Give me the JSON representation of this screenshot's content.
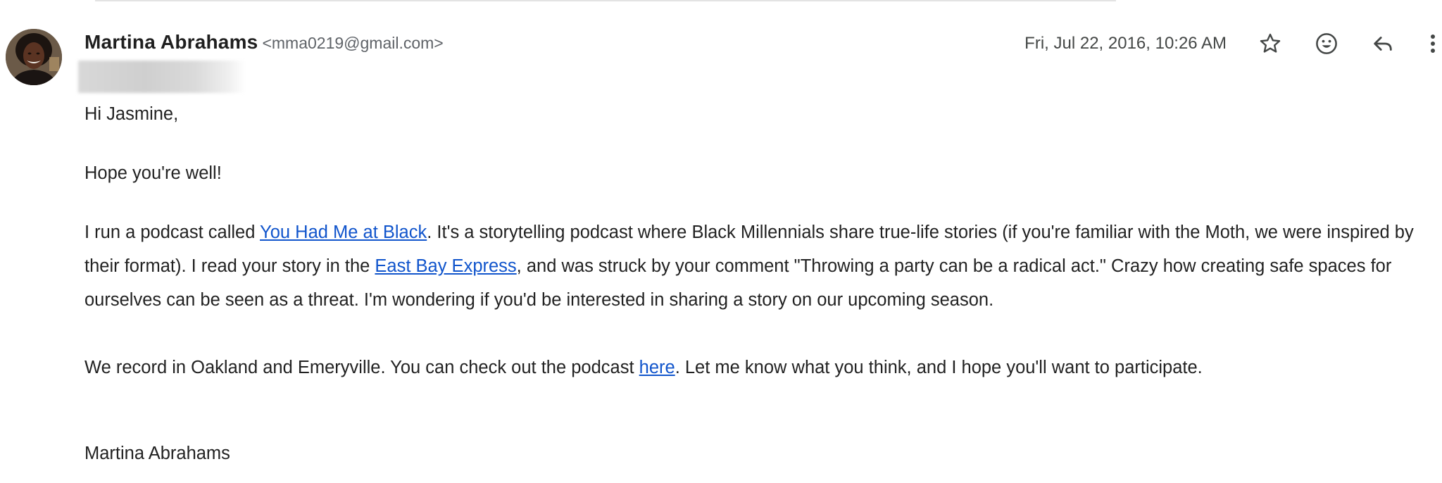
{
  "email": {
    "sender_name": "Martina Abrahams",
    "sender_email": "<mma0219@gmail.com>",
    "date": "Fri, Jul 22, 2016, 10:26 AM",
    "icons": {
      "star": "star-icon",
      "emoji": "emoji-icon",
      "reply": "reply-icon",
      "more": "more-vert-icon"
    },
    "body": {
      "greeting": "Hi Jasmine,",
      "line2": "Hope you're well!",
      "p3_a": "I run a podcast called ",
      "p3_link1": "You Had Me at Black",
      "p3_b": ". It's a storytelling podcast where Black Millennials share true-life stories (if you're familiar with the Moth, we were inspired by their format). I read your story in the ",
      "p3_link2": "East Bay Express",
      "p3_c": ", and was struck by your comment \"Throwing a party can be a radical act.\" Crazy how creating safe spaces for ourselves can be seen as a threat. I'm wondering if you'd be interested in sharing a story on our upcoming season.",
      "p4_a": "We record in Oakland and Emeryville. You can check out the podcast ",
      "p4_link": "here",
      "p4_b": ". Let me know what you think, and I hope you'll want to participate.",
      "signature": "Martina Abrahams"
    }
  },
  "colors": {
    "link": "#1155cc",
    "text": "#222222",
    "secondary": "#5f6368"
  }
}
